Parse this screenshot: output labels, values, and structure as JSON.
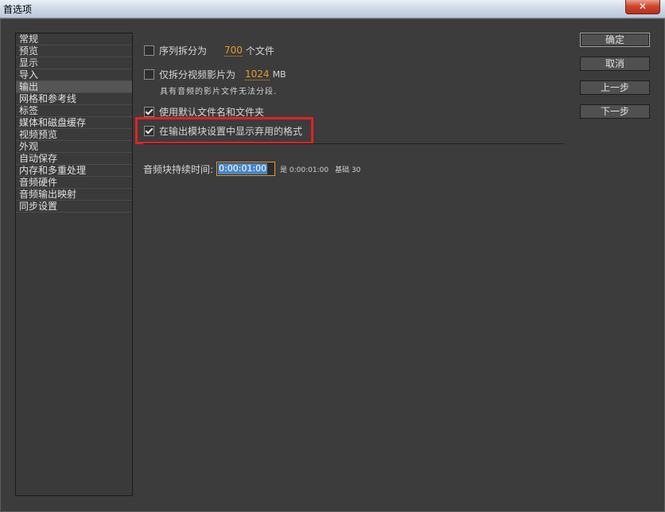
{
  "window": {
    "title": "首选项",
    "close_glyph": "✕"
  },
  "sidebar": {
    "items": [
      {
        "label": "常规"
      },
      {
        "label": "预览"
      },
      {
        "label": "显示"
      },
      {
        "label": "导入"
      },
      {
        "label": "输出",
        "selected": true
      },
      {
        "label": "网格和参考线"
      },
      {
        "label": "标签"
      },
      {
        "label": "媒体和磁盘缓存"
      },
      {
        "label": "视频预览"
      },
      {
        "label": "外观"
      },
      {
        "label": "自动保存"
      },
      {
        "label": "内存和多重处理"
      },
      {
        "label": "音频硬件"
      },
      {
        "label": "音频输出映射"
      },
      {
        "label": "同步设置"
      }
    ]
  },
  "output": {
    "split_sequence": {
      "checked": false,
      "label": "序列拆分为",
      "value": "700",
      "unit": "个文件"
    },
    "split_video": {
      "checked": false,
      "label": "仅拆分视频影片为",
      "value": "1024",
      "unit": "MB"
    },
    "note": "具有音频的影片文件无法分段.",
    "default_filename": {
      "checked": true,
      "label": "使用默认文件名和文件夹"
    },
    "show_deprecated": {
      "checked": true,
      "label": "在输出模块设置中显示弃用的格式"
    },
    "audio_block": {
      "label": "音频块持续时间:",
      "value": "0:00:01:00",
      "equals": "是 0:00:01:00",
      "base": "基础 30"
    }
  },
  "buttons": {
    "ok": "确定",
    "cancel": "取消",
    "prev": "上一步",
    "next": "下一步"
  },
  "colors": {
    "accent": "#e39b2d",
    "highlight_box": "#e12222"
  }
}
